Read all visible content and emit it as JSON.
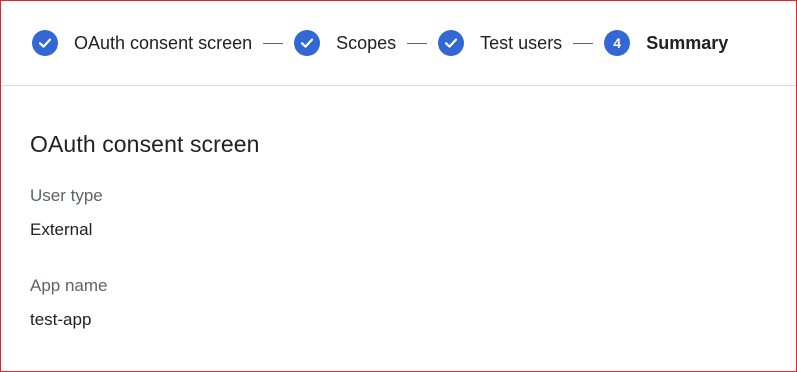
{
  "stepper": {
    "steps": [
      {
        "label": "OAuth consent screen",
        "state": "completed",
        "icon": "check-icon"
      },
      {
        "label": "Scopes",
        "state": "completed",
        "icon": "check-icon"
      },
      {
        "label": "Test users",
        "state": "completed",
        "icon": "check-icon"
      },
      {
        "label": "Summary",
        "state": "active",
        "number": "4"
      }
    ]
  },
  "summary": {
    "section_title": "OAuth consent screen",
    "fields": [
      {
        "label": "User type",
        "value": "External"
      },
      {
        "label": "App name",
        "value": "test-app"
      }
    ]
  },
  "colors": {
    "accent": "#3367d6",
    "frame_border": "#e0262b",
    "label_gray": "#5f6368",
    "text": "#202124"
  }
}
